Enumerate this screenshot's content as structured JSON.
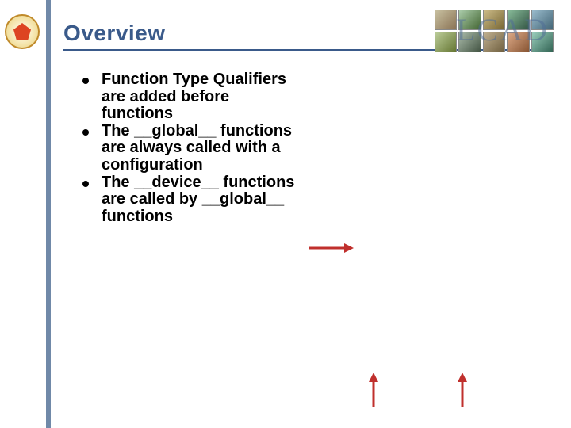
{
  "title": "Overview",
  "logo_name": "institution-seal",
  "lcad_label": "LCAD",
  "bullets": [
    "Function Type Qualifiers are added before functions",
    "The __global__ functions are always called with a configuration",
    " The __device__ functions are called by __global__ functions"
  ],
  "colors": {
    "title": "#3a5a8a",
    "left_bar": "#7089a8",
    "arrow": "#c0302d"
  }
}
